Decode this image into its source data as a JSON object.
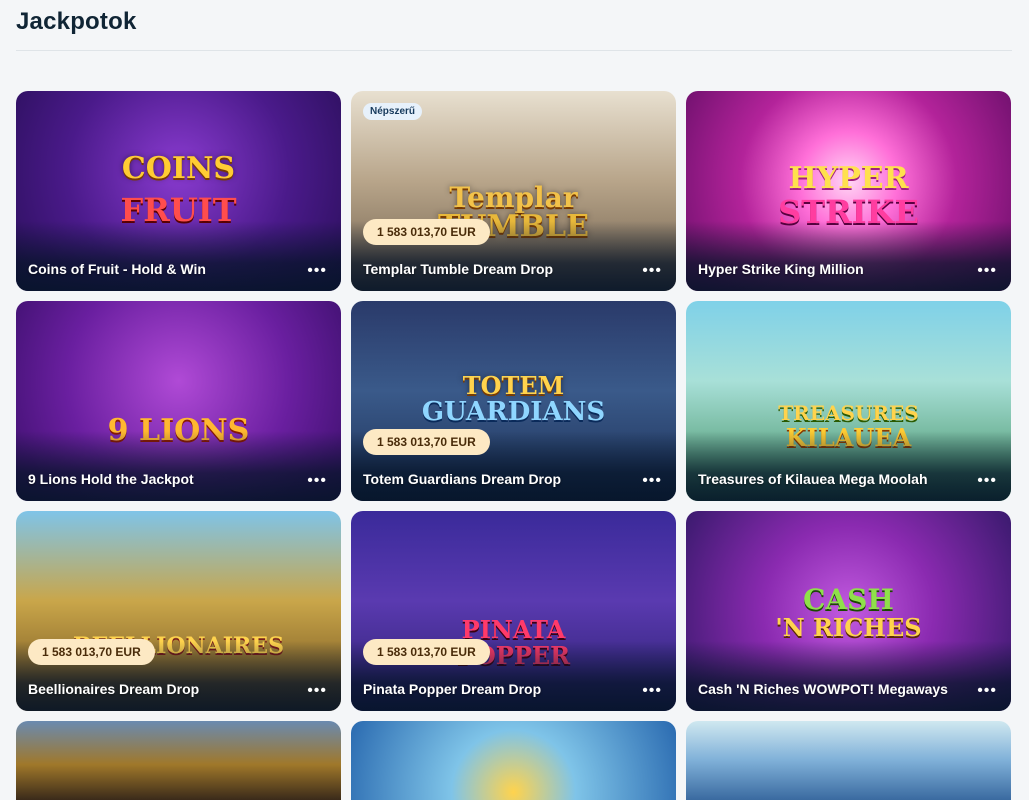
{
  "page": {
    "title": "Jackpotok"
  },
  "games": [
    {
      "title": "Coins of Fruit - Hold & Win",
      "jackpot": "",
      "badge": "",
      "logo": "COINS FRUIT",
      "colors": [
        "#3c1a7a",
        "#7b2bb5"
      ]
    },
    {
      "title": "Templar Tumble Dream Drop",
      "jackpot": "1 583 013,70 EUR",
      "badge": "Népszerű",
      "logo": "Templar TUMBLE",
      "colors": [
        "#6b5b4b",
        "#c9b79c"
      ]
    },
    {
      "title": "Hyper Strike King Million",
      "jackpot": "",
      "badge": "",
      "logo": "HYPER STRIKE",
      "colors": [
        "#9a1d7a",
        "#ff5bd0"
      ]
    },
    {
      "title": "9 Lions Hold the Jackpot",
      "jackpot": "",
      "badge": "",
      "logo": "9 LIONS",
      "colors": [
        "#4a1a7a",
        "#9b37c9"
      ]
    },
    {
      "title": "Totem Guardians Dream Drop",
      "jackpot": "1 583 013,70 EUR",
      "badge": "",
      "logo": "TOTEM GUARDIANS",
      "colors": [
        "#1c2f55",
        "#3a5a8a"
      ]
    },
    {
      "title": "Treasures of Kilauea Mega Moolah",
      "jackpot": "",
      "badge": "",
      "logo": "TREASURES KILAUEA",
      "colors": [
        "#2c8aa8",
        "#7fd1c8"
      ]
    },
    {
      "title": "Beellionaires Dream Drop",
      "jackpot": "1 583 013,70 EUR",
      "badge": "",
      "logo": "BEELLIONAIRES",
      "colors": [
        "#4a6e3a",
        "#c9a64a"
      ]
    },
    {
      "title": "Pinata Popper Dream Drop",
      "jackpot": "1 583 013,70 EUR",
      "badge": "",
      "logo": "PINATA POPPER",
      "colors": [
        "#2a1f6e",
        "#5a3ab0"
      ]
    },
    {
      "title": "Cash 'N Riches WOWPOT! Megaways",
      "jackpot": "",
      "badge": "",
      "logo": "CASH N RICHES",
      "colors": [
        "#3a1a6e",
        "#a23ad0"
      ]
    }
  ],
  "partial_row": [
    {
      "colors": [
        "#3a2a1a",
        "#a0782a"
      ]
    },
    {
      "colors": [
        "#2a6ab0",
        "#7fc4e8"
      ]
    },
    {
      "colors": [
        "#3a6aa0",
        "#cfe8f0"
      ]
    }
  ],
  "more_label": "•••"
}
